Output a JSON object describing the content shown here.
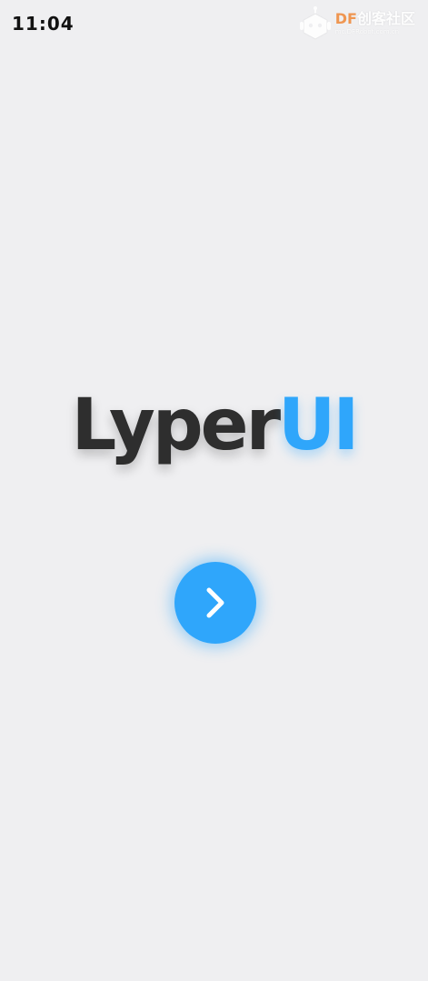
{
  "status_bar": {
    "time": "11:04"
  },
  "watermark": {
    "brand_latin": "DF",
    "brand_cn": "创客社区",
    "url": "mc.DFRobot.com.cn"
  },
  "logo": {
    "part1": "Lyper",
    "part2": "UI"
  },
  "next_button": {
    "icon": "chevron-right-icon"
  },
  "colors": {
    "background": "#efeff1",
    "accent": "#2fa6fb",
    "logo_dark": "#2e2e2e",
    "watermark_orange": "#f08a3c"
  }
}
